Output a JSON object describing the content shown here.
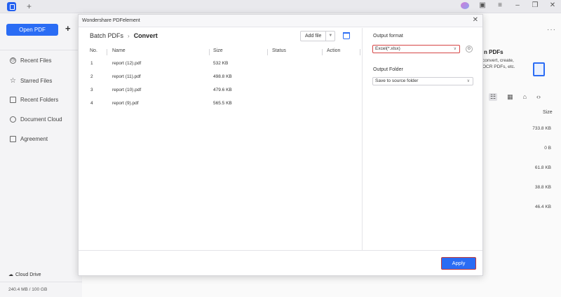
{
  "sidebar": {
    "open_pdf": "Open PDF",
    "items": [
      {
        "label": "Recent Files",
        "icon": "clock-icon"
      },
      {
        "label": "Starred Files",
        "icon": "star-icon"
      },
      {
        "label": "Recent Folders",
        "icon": "folder-icon"
      },
      {
        "label": "Document Cloud",
        "icon": "cloud-icon"
      },
      {
        "label": "Agreement",
        "icon": "document-icon"
      }
    ],
    "cloud_drive": "Cloud Drive",
    "storage": "240.4 MB / 100 GB"
  },
  "background": {
    "promo_title": "n PDFs",
    "promo_text": "convert, create, OCR PDFs, etc.",
    "size_header": "Size",
    "sizes": [
      "733.8 KB",
      "0 B",
      "61.8 KB",
      "38.8 KB",
      "46.4 KB"
    ]
  },
  "modal": {
    "title": "Wondershare PDFelement",
    "breadcrumb": {
      "parent": "Batch PDFs",
      "current": "Convert"
    },
    "add_file": "Add file",
    "columns": {
      "no": "No.",
      "name": "Name",
      "size": "Size",
      "status": "Status",
      "action": "Action"
    },
    "files": [
      {
        "no": "1",
        "name": "report (12).pdf",
        "size": "532 KB"
      },
      {
        "no": "2",
        "name": "report (11).pdf",
        "size": "498.8 KB"
      },
      {
        "no": "3",
        "name": "report (10).pdf",
        "size": "479.6 KB"
      },
      {
        "no": "4",
        "name": "report (9).pdf",
        "size": "565.5 KB"
      }
    ],
    "output_format_label": "Output format",
    "output_format_value": "Excel(*.xlsx)",
    "output_folder_label": "Output Folder",
    "output_folder_value": "Save to source folder",
    "apply": "Apply"
  },
  "colors": {
    "accent": "#2a6cf4",
    "highlight": "#d64545"
  }
}
